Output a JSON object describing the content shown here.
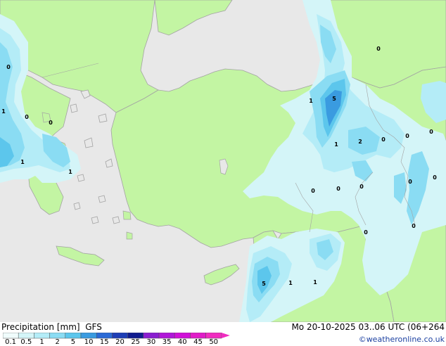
{
  "title": "Precipitation [mm]",
  "model": "GFS",
  "valid_time": "Mo 20-10-2025 03..06 UTC (06+264",
  "credit": "©weatheronline.co.uk",
  "colors": {
    "sea": "#e8e8e8",
    "land": "#c3f5a3",
    "coast": "#a3a3a3",
    "precip_01": "#d4f5f8",
    "precip_05": "#b4ecf7",
    "precip_1": "#8adcf3",
    "precip_2": "#5cc6ec",
    "precip_5": "#3a9be0"
  },
  "colorbar": {
    "labels": [
      "0.1",
      "0.5",
      "1",
      "2",
      "5",
      "10",
      "15",
      "20",
      "25",
      "30",
      "35",
      "40",
      "45",
      "50"
    ],
    "colors": [
      "#f0fcfc",
      "#d4f5f8",
      "#b4ecf7",
      "#8adcf3",
      "#5cc6ec",
      "#3a9be0",
      "#2a6ad6",
      "#1e3eb6",
      "#101c8e",
      "#8a1ed0",
      "#b016d8",
      "#d010d8",
      "#e01cc8",
      "#f02cc0"
    ]
  },
  "precip_values": [
    {
      "id": "v1",
      "text": "0"
    },
    {
      "id": "v2",
      "text": "1"
    },
    {
      "id": "v3",
      "text": "0"
    },
    {
      "id": "v4",
      "text": "0"
    },
    {
      "id": "v5",
      "text": "1"
    },
    {
      "id": "v6",
      "text": "1"
    },
    {
      "id": "v7",
      "text": "0"
    },
    {
      "id": "v8",
      "text": "1"
    },
    {
      "id": "v9",
      "text": "5"
    },
    {
      "id": "v10",
      "text": "1"
    },
    {
      "id": "v11",
      "text": "2"
    },
    {
      "id": "v12",
      "text": "0"
    },
    {
      "id": "v13",
      "text": "0"
    },
    {
      "id": "v14",
      "text": "0"
    },
    {
      "id": "v15",
      "text": "0"
    },
    {
      "id": "v16",
      "text": "0"
    },
    {
      "id": "v17",
      "text": "0"
    },
    {
      "id": "v18",
      "text": "0"
    },
    {
      "id": "v19",
      "text": "0"
    },
    {
      "id": "v20",
      "text": "0"
    },
    {
      "id": "v21",
      "text": "0"
    },
    {
      "id": "v22",
      "text": "5"
    },
    {
      "id": "v23",
      "text": "1"
    },
    {
      "id": "v24",
      "text": "1"
    }
  ]
}
